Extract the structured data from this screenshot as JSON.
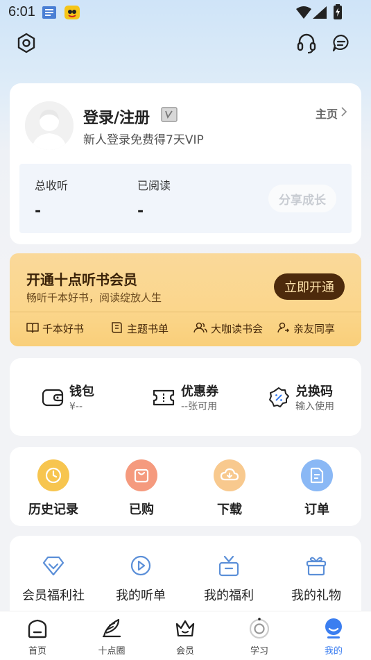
{
  "status_bar": {
    "time": "6:01"
  },
  "profile": {
    "login_label": "登录/注册",
    "promo": "新人登录免费得7天VIP",
    "home_link": "主页",
    "stats": [
      {
        "label": "总收听",
        "value": "-"
      },
      {
        "label": "已阅读",
        "value": "-"
      }
    ],
    "share_button": "分享成长"
  },
  "vip": {
    "title": "开通十点听书会员",
    "subtitle": "畅听千本好书，阅读绽放人生",
    "button": "立即开通",
    "features": [
      "千本好书",
      "主题书单",
      "大咖读书会",
      "亲友同享"
    ],
    "colors": {
      "button_bg": "#4d2a0c",
      "card_bg": "#fad99a"
    }
  },
  "wallet": {
    "items": [
      {
        "title": "钱包",
        "sub": "¥--",
        "icon": "wallet-icon"
      },
      {
        "title": "优惠券",
        "sub": "--张可用",
        "icon": "coupon-icon"
      },
      {
        "title": "兑换码",
        "sub": "输入使用",
        "icon": "redeem-icon"
      }
    ]
  },
  "quick": {
    "items": [
      {
        "label": "历史记录",
        "icon": "clock-icon",
        "color": "#f7c54f"
      },
      {
        "label": "已购",
        "icon": "bag-icon",
        "color": "#f59a7e"
      },
      {
        "label": "下载",
        "icon": "cloud-download-icon",
        "color": "#f8c98e"
      },
      {
        "label": "订单",
        "icon": "document-icon",
        "color": "#8ab8f5"
      }
    ]
  },
  "more": {
    "items": [
      {
        "label": "会员福利社",
        "icon": "diamond-icon"
      },
      {
        "label": "我的听单",
        "icon": "play-circle-icon"
      },
      {
        "label": "我的福利",
        "icon": "gift-box-icon"
      },
      {
        "label": "我的礼物",
        "icon": "gift-icon"
      }
    ]
  },
  "tabs": [
    {
      "label": "首页",
      "icon": "home-icon"
    },
    {
      "label": "十点圈",
      "icon": "feather-icon"
    },
    {
      "label": "会员",
      "icon": "crown-icon"
    },
    {
      "label": "学习",
      "icon": "study-icon"
    },
    {
      "label": "我的",
      "icon": "profile-icon",
      "active": true
    }
  ],
  "accent_color": "#3b7ef0"
}
